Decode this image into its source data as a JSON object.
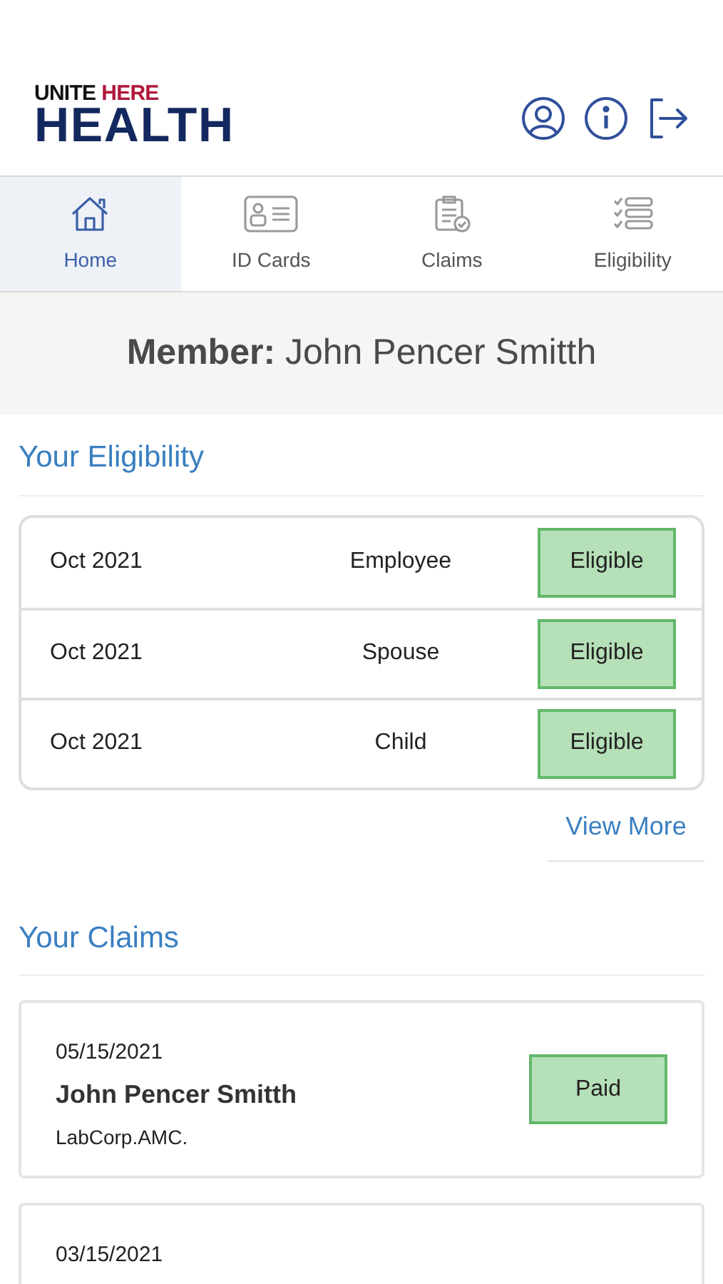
{
  "logo": {
    "line_1_part_1": "UNITE",
    "line_1_part_2": "HERE",
    "line_2": "HEALTH"
  },
  "tabs": [
    {
      "label": "Home",
      "kind": "home",
      "selected": true
    },
    {
      "label": "ID Cards",
      "kind": "idcard",
      "selected": false
    },
    {
      "label": "Claims",
      "kind": "claims",
      "selected": false
    },
    {
      "label": "Eligibility",
      "kind": "list",
      "selected": false
    }
  ],
  "member": {
    "label": "Member:",
    "name": "John Pencer Smitth"
  },
  "eligibility": {
    "title": "Your Eligibility",
    "rows": [
      {
        "period": "Oct 2021",
        "relation": "Employee",
        "status": "Eligible"
      },
      {
        "period": "Oct 2021",
        "relation": "Spouse",
        "status": "Eligible"
      },
      {
        "period": "Oct 2021",
        "relation": "Child",
        "status": "Eligible"
      }
    ],
    "link": "View More"
  },
  "claims": {
    "title": "Your Claims",
    "items": [
      {
        "date": "05/15/2021",
        "name": "John Pencer Smitth",
        "provider": "LabCorp.AMC.",
        "status": "Paid"
      },
      {
        "date": "03/15/2021"
      }
    ]
  }
}
